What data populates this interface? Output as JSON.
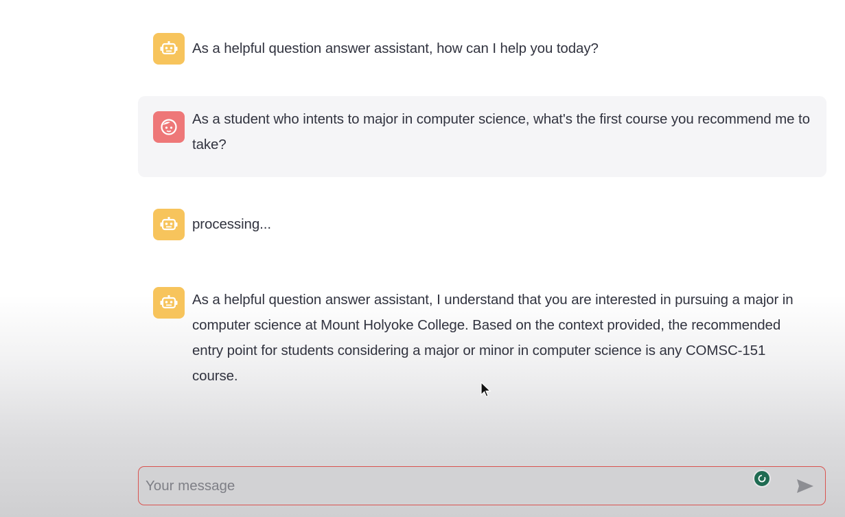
{
  "messages": [
    {
      "role": "assistant",
      "avatar": "robot-icon",
      "text": "As a helpful question answer assistant, how can I help you today?"
    },
    {
      "role": "user",
      "avatar": "user-face-icon",
      "text": "As a student who intents to major in computer science, what's the first course you recommend me to take?"
    },
    {
      "role": "assistant",
      "avatar": "robot-icon",
      "text": "processing..."
    },
    {
      "role": "assistant",
      "avatar": "robot-icon",
      "text": "As a helpful question answer assistant, I understand that you are interested in pursuing a major in computer science at Mount Holyoke College. Based on the context provided, the recommended entry point for students considering a major or minor in computer science is any COMSC-151 course."
    }
  ],
  "chat_input": {
    "value": "",
    "placeholder": "Your message",
    "send_icon": "send-icon",
    "grammar_icon": "grammarly-icon"
  },
  "colors": {
    "bot_avatar": "#f7c45c",
    "user_avatar": "#ee7778",
    "user_bubble": "#f5f5f7",
    "input_border": "#d9534f",
    "text": "#31333f"
  }
}
